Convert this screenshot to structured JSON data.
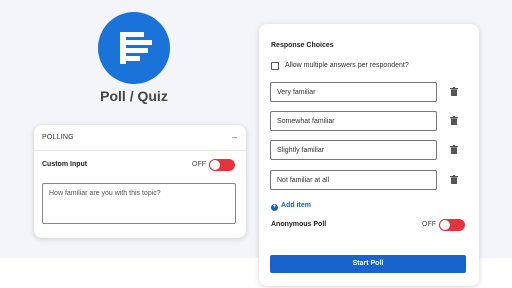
{
  "app": {
    "title": "Poll / Quiz"
  },
  "polling_panel": {
    "header_label": "POLLING",
    "collapse_symbol": "–",
    "custom_input_label": "Custom Input",
    "custom_input_toggle_text": "OFF",
    "question_text": "How familiar are you with this topic?"
  },
  "response_panel": {
    "title": "Response Choices",
    "multiple_answers_label": "Allow multiple answers per respondent?",
    "choices": [
      {
        "label": "Very familiar"
      },
      {
        "label": "Somewhat familiar"
      },
      {
        "label": "Slightly familiar"
      },
      {
        "label": "Not familiar at all"
      }
    ],
    "add_item_label": "Add item",
    "add_item_symbol": "+",
    "anonymous_label": "Anonymous Poll",
    "anonymous_toggle_text": "OFF",
    "start_label": "Start Poll"
  },
  "colors": {
    "accent": "#1a73d9",
    "toggle_off": "#e5333b",
    "button": "#1765cc"
  }
}
